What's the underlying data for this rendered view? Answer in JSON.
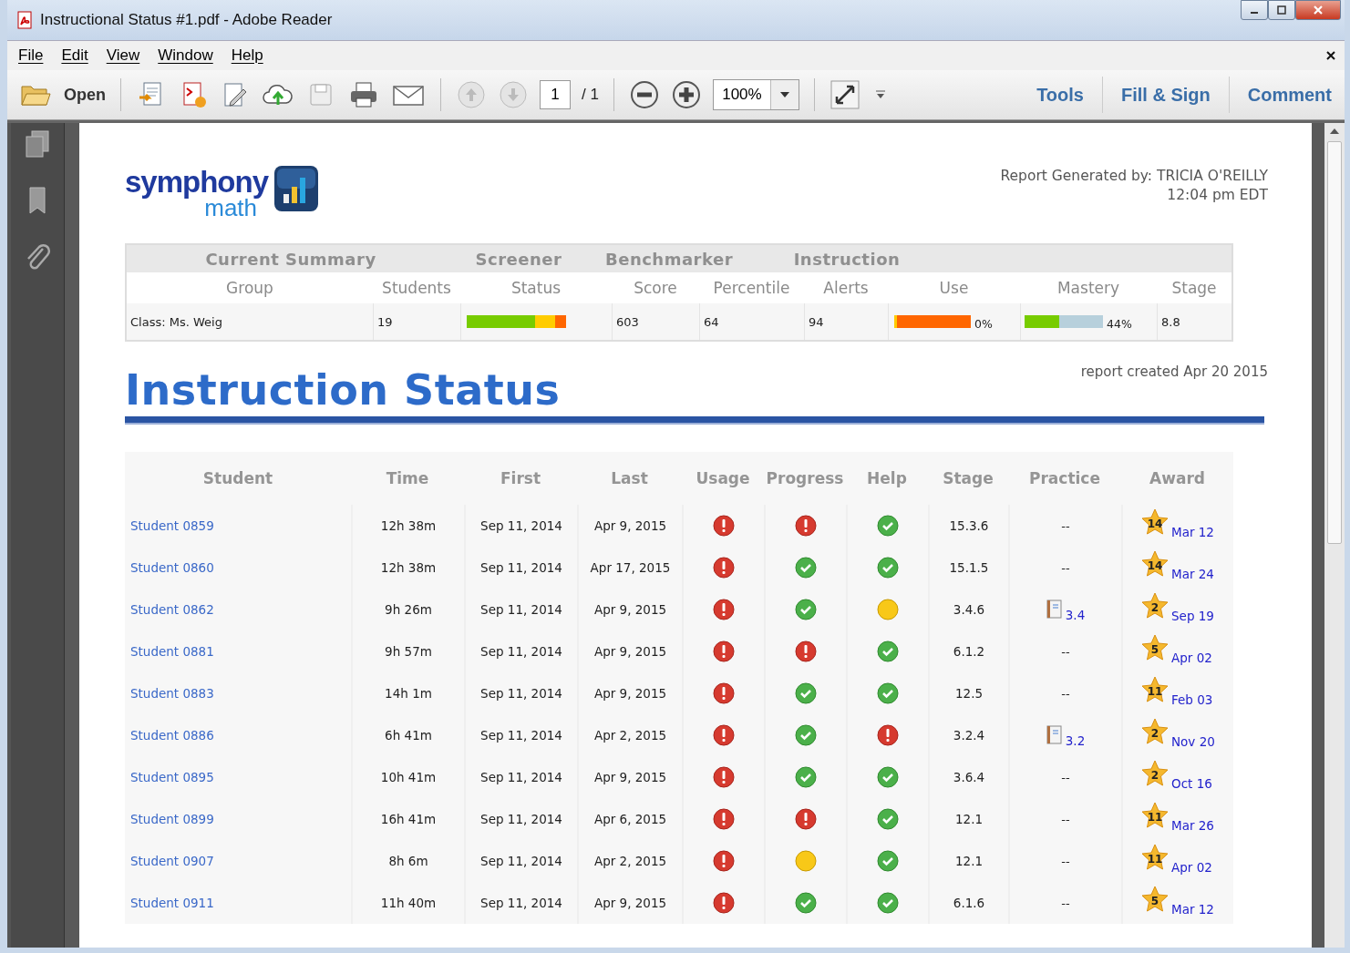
{
  "window": {
    "title": "Instructional Status #1.pdf - Adobe Reader"
  },
  "menu": [
    "File",
    "Edit",
    "View",
    "Window",
    "Help"
  ],
  "toolbar": {
    "open": "Open",
    "page": "1",
    "page_total": "/ 1",
    "zoom": "100%",
    "tabs": [
      "Tools",
      "Fill & Sign",
      "Comment"
    ]
  },
  "report": {
    "logo": {
      "brand": "symphony",
      "sub": "math"
    },
    "generated_by": "Report Generated by: TRICIA O'REILLY",
    "generated_time": "12:04 pm EDT",
    "summary": {
      "groups": [
        "Current Summary",
        "Screener",
        "Benchmarker",
        "Instruction"
      ],
      "columns": [
        "Group",
        "Students",
        "Status",
        "Score",
        "Percentile",
        "Alerts",
        "Use",
        "Mastery",
        "Stage"
      ],
      "row": {
        "group": "Class: Ms. Weig",
        "students": "19",
        "status": [
          {
            "color": "#77cc00"
          },
          {
            "color": "#ffcc00"
          },
          {
            "color": "#ff6600"
          }
        ],
        "score": "603",
        "percentile": "64",
        "alerts": "94",
        "use": [
          {
            "color": "#ffcc00"
          },
          {
            "color": "#ff6600"
          }
        ],
        "use_reading": "0%",
        "mastery": {
          "level": 0.44
        },
        "mastery_reading": "44%",
        "stage": "8.8"
      }
    },
    "title": "Instruction Status",
    "created": "report created Apr 20 2015",
    "table": {
      "columns": [
        "Student",
        "Time",
        "First",
        "Last",
        "Usage",
        "Progress",
        "Help",
        "Stage",
        "Practice",
        "Award"
      ],
      "rows": [
        {
          "student": "Student 0859",
          "time": "12h 38m",
          "first": "Sep 11, 2014",
          "last": "Apr 9, 2015",
          "usage": {
            "kind": "alert"
          },
          "progress": {
            "kind": "alert"
          },
          "help": {
            "kind": "ok"
          },
          "stage": "15.3.6",
          "practice": {
            "kind": "none",
            "text": "--"
          },
          "award": {
            "number": "14",
            "date": "Mar 12"
          }
        },
        {
          "student": "Student 0860",
          "time": "12h 38m",
          "first": "Sep 11, 2014",
          "last": "Apr 17, 2015",
          "usage": {
            "kind": "alert"
          },
          "progress": {
            "kind": "ok"
          },
          "help": {
            "kind": "ok"
          },
          "stage": "15.1.5",
          "practice": {
            "kind": "none",
            "text": "--"
          },
          "award": {
            "number": "14",
            "date": "Mar 24"
          }
        },
        {
          "student": "Student 0862",
          "time": "9h 26m",
          "first": "Sep 11, 2014",
          "last": "Apr 9, 2015",
          "usage": {
            "kind": "alert"
          },
          "progress": {
            "kind": "ok"
          },
          "help": {
            "kind": "warn"
          },
          "stage": "3.4.6",
          "practice": {
            "kind": "doc",
            "text": "3.4"
          },
          "award": {
            "number": "2",
            "date": "Sep 19"
          }
        },
        {
          "student": "Student 0881",
          "time": "9h 57m",
          "first": "Sep 11, 2014",
          "last": "Apr 9, 2015",
          "usage": {
            "kind": "alert"
          },
          "progress": {
            "kind": "alert"
          },
          "help": {
            "kind": "ok"
          },
          "stage": "6.1.2",
          "practice": {
            "kind": "none",
            "text": "--"
          },
          "award": {
            "number": "5",
            "date": "Apr 02"
          }
        },
        {
          "student": "Student 0883",
          "time": "14h 1m",
          "first": "Sep 11, 2014",
          "last": "Apr 9, 2015",
          "usage": {
            "kind": "alert"
          },
          "progress": {
            "kind": "ok"
          },
          "help": {
            "kind": "ok"
          },
          "stage": "12.5",
          "practice": {
            "kind": "none",
            "text": "--"
          },
          "award": {
            "number": "11",
            "date": "Feb 03"
          }
        },
        {
          "student": "Student 0886",
          "time": "6h 41m",
          "first": "Sep 11, 2014",
          "last": "Apr 2, 2015",
          "usage": {
            "kind": "alert"
          },
          "progress": {
            "kind": "ok"
          },
          "help": {
            "kind": "alert"
          },
          "stage": "3.2.4",
          "practice": {
            "kind": "doc",
            "text": "3.2"
          },
          "award": {
            "number": "2",
            "date": "Nov 20"
          }
        },
        {
          "student": "Student 0895",
          "time": "10h 41m",
          "first": "Sep 11, 2014",
          "last": "Apr 9, 2015",
          "usage": {
            "kind": "alert"
          },
          "progress": {
            "kind": "ok"
          },
          "help": {
            "kind": "ok"
          },
          "stage": "3.6.4",
          "practice": {
            "kind": "none",
            "text": "--"
          },
          "award": {
            "number": "2",
            "date": "Oct 16"
          }
        },
        {
          "student": "Student 0899",
          "time": "16h 41m",
          "first": "Sep 11, 2014",
          "last": "Apr 6, 2015",
          "usage": {
            "kind": "alert"
          },
          "progress": {
            "kind": "alert"
          },
          "help": {
            "kind": "ok"
          },
          "stage": "12.1",
          "practice": {
            "kind": "none",
            "text": "--"
          },
          "award": {
            "number": "11",
            "date": "Mar 26"
          }
        },
        {
          "student": "Student 0907",
          "time": "8h 6m",
          "first": "Sep 11, 2014",
          "last": "Apr 2, 2015",
          "usage": {
            "kind": "alert"
          },
          "progress": {
            "kind": "warn"
          },
          "help": {
            "kind": "ok"
          },
          "stage": "12.1",
          "practice": {
            "kind": "none",
            "text": "--"
          },
          "award": {
            "number": "11",
            "date": "Apr 02"
          }
        },
        {
          "student": "Student 0911",
          "time": "11h 40m",
          "first": "Sep 11, 2014",
          "last": "Apr 9, 2015",
          "usage": {
            "kind": "alert"
          },
          "progress": {
            "kind": "ok"
          },
          "help": {
            "kind": "ok"
          },
          "stage": "6.1.6",
          "practice": {
            "kind": "none",
            "text": "--"
          },
          "award": {
            "number": "5",
            "date": "Mar 12"
          }
        }
      ]
    }
  }
}
